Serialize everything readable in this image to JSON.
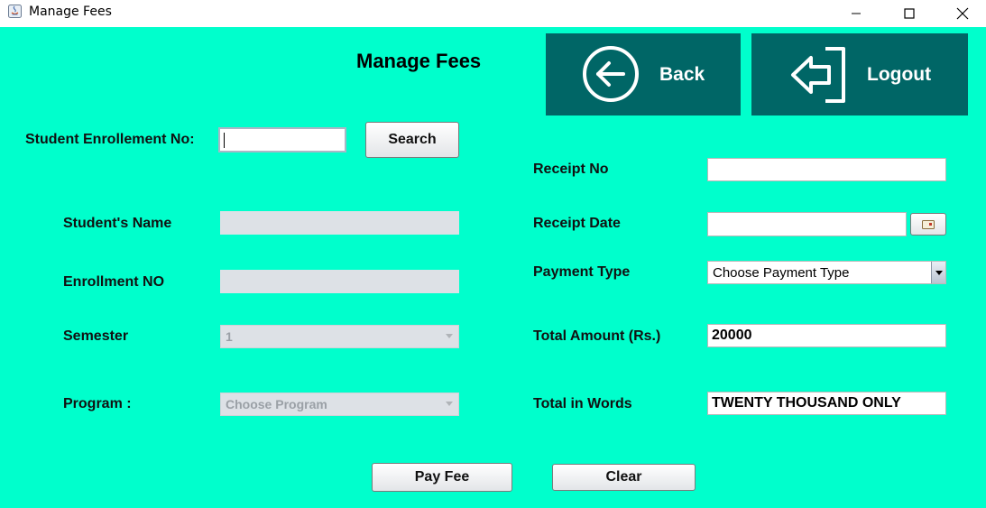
{
  "window": {
    "title": "Manage Fees"
  },
  "header": {
    "title": "Manage Fees",
    "back_label": "Back",
    "logout_label": "Logout"
  },
  "search": {
    "label": "Student Enrollement No:",
    "value": "",
    "button_label": "Search"
  },
  "left_form": {
    "name_label": "Student's Name",
    "name_value": "",
    "enrollment_label": "Enrollment NO",
    "enrollment_value": "",
    "semester_label": "Semester",
    "semester_value": "1",
    "program_label": "Program :",
    "program_value": "Choose Program"
  },
  "right_form": {
    "receipt_no_label": "Receipt No",
    "receipt_no_value": "",
    "receipt_date_label": "Receipt Date",
    "receipt_date_value": "",
    "payment_type_label": "Payment Type",
    "payment_type_value": "Choose Payment Type",
    "total_amount_label": "Total Amount (Rs.)",
    "total_amount_value": "20000",
    "total_words_label": "Total in Words",
    "total_words_value": "TWENTY THOUSAND ONLY"
  },
  "actions": {
    "pay_label": "Pay Fee",
    "clear_label": "Clear"
  },
  "colors": {
    "background": "#00ffcc",
    "header_button": "#006666",
    "disabled_field": "#dde1e6"
  }
}
